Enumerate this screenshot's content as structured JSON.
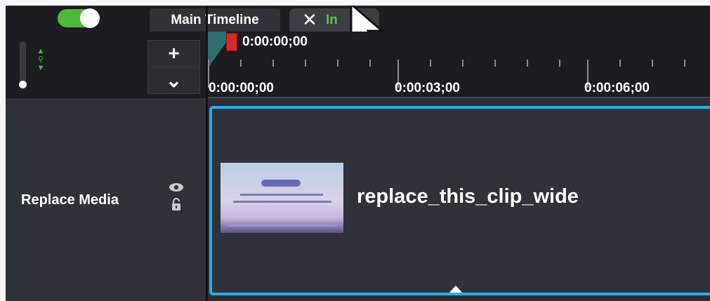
{
  "tabs": {
    "main": "Main Timeline",
    "second_label_visible": "In"
  },
  "controls": {
    "add_label": "+",
    "expand_label": "⌄"
  },
  "ruler": {
    "playhead_time": "0:00:00;00",
    "time_labels": [
      "0:00:00;00",
      "0:00:03;00",
      "0:00:06;00"
    ]
  },
  "track": {
    "name": "Replace Media"
  },
  "clip": {
    "name": "replace_this_clip_wide"
  },
  "colors": {
    "accent_green": "#4fb83a",
    "selection_blue": "#27aee8",
    "playhead_red": "#d32b2b"
  }
}
